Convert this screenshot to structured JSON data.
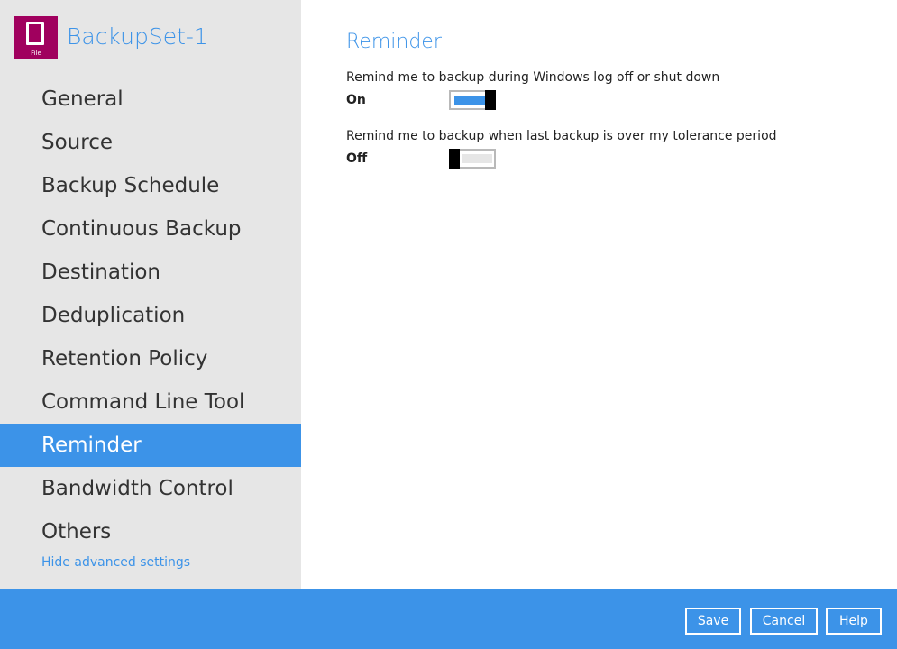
{
  "sidebar": {
    "logo_label": "File",
    "title": "BackupSet-1",
    "items": [
      {
        "label": "General"
      },
      {
        "label": "Source"
      },
      {
        "label": "Backup Schedule"
      },
      {
        "label": "Continuous Backup"
      },
      {
        "label": "Destination"
      },
      {
        "label": "Deduplication"
      },
      {
        "label": "Retention Policy"
      },
      {
        "label": "Command Line Tool"
      },
      {
        "label": "Reminder",
        "active": true
      },
      {
        "label": "Bandwidth Control"
      },
      {
        "label": "Others"
      }
    ],
    "hide_advanced": "Hide advanced settings"
  },
  "main": {
    "heading": "Reminder",
    "settings": [
      {
        "description": "Remind me to backup during Windows log off or shut down",
        "state": "On",
        "enabled": true
      },
      {
        "description": "Remind me to backup when last backup is over my tolerance period",
        "state": "Off",
        "enabled": false
      }
    ]
  },
  "footer": {
    "save": "Save",
    "cancel": "Cancel",
    "help": "Help"
  },
  "colors": {
    "accent": "#3c93e8",
    "logo": "#a0005e",
    "sidebar": "#e6e6e6"
  }
}
